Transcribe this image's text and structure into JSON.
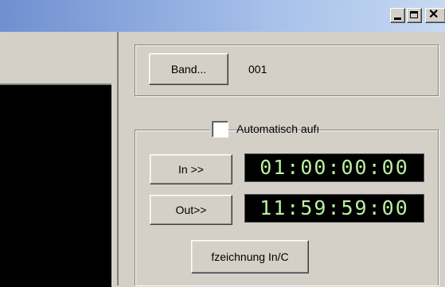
{
  "window": {
    "minimize_icon": "minimize-icon",
    "maximize_icon": "maximize-icon",
    "close_glyph": "✕"
  },
  "band": {
    "button_label": "Band...",
    "value": "001"
  },
  "auto_record": {
    "checkbox_label": "Automatisch aufı",
    "checked": false
  },
  "in_point": {
    "button_label": "In >>",
    "timecode": "01:00:00:00"
  },
  "out_point": {
    "button_label": "Out>>",
    "timecode": "11:59:59:00"
  },
  "record_button_label": "fzeichnung In/C",
  "colors": {
    "titlebar_start": "#6f8fd0",
    "titlebar_end": "#c7d9f2",
    "dialog_face": "#d4d0c8",
    "timecode_text": "#b9f0a0",
    "timecode_bg": "#000000"
  }
}
